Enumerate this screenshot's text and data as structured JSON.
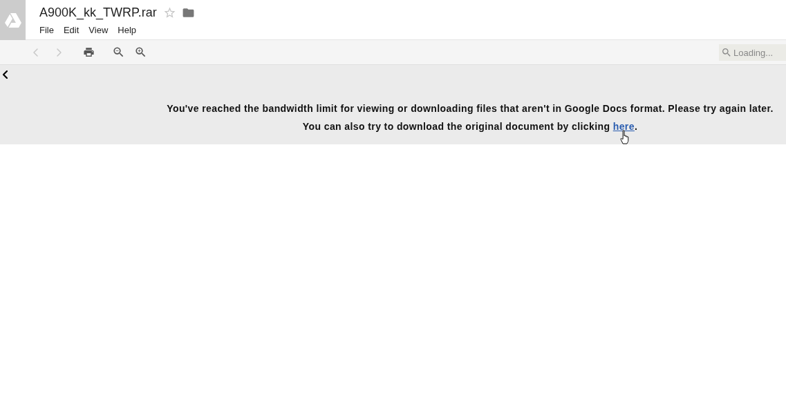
{
  "header": {
    "title": "A900K_kk_TWRP.rar",
    "starred": false,
    "menu": [
      "File",
      "Edit",
      "View",
      "Help"
    ]
  },
  "toolbar": {
    "buttons": [
      {
        "kind": "back",
        "disabled": true
      },
      {
        "kind": "forward",
        "disabled": true
      },
      {
        "kind": "print",
        "disabled": false
      },
      {
        "kind": "zoom_out",
        "disabled": false
      },
      {
        "kind": "zoom_in",
        "disabled": false
      }
    ],
    "search": {
      "placeholder": "Loading..."
    }
  },
  "message": {
    "line_1": "You've reached the bandwidth limit for viewing or downloading files that aren't in Google Docs format. Please try again later.",
    "line_2": {
      "text": "You can also try to download the original document by clicking ",
      "link": "here",
      "after": "."
    }
  }
}
